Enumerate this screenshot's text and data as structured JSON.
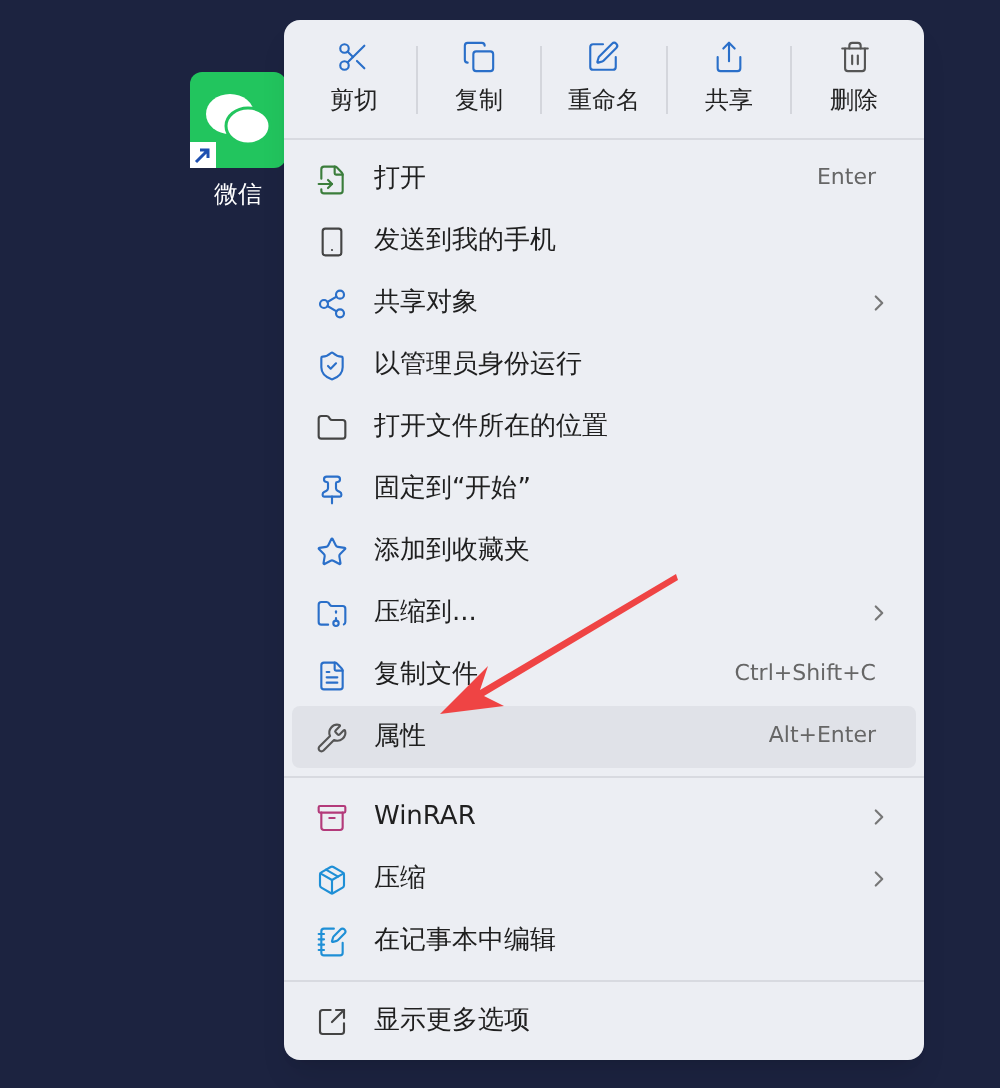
{
  "desktop_icon": {
    "label": "微信"
  },
  "toolbar": [
    {
      "label": "剪切"
    },
    {
      "label": "复制"
    },
    {
      "label": "重命名"
    },
    {
      "label": "共享"
    },
    {
      "label": "删除"
    }
  ],
  "menu_groups": [
    [
      {
        "label": "打开",
        "shortcut": "Enter",
        "submenu": false,
        "selected": false
      },
      {
        "label": "发送到我的手机",
        "submenu": false,
        "selected": false
      },
      {
        "label": "共享对象",
        "submenu": true,
        "selected": false
      },
      {
        "label": "以管理员身份运行",
        "submenu": false,
        "selected": false
      },
      {
        "label": "打开文件所在的位置",
        "submenu": false,
        "selected": false
      },
      {
        "label": "固定到“开始”",
        "submenu": false,
        "selected": false
      },
      {
        "label": "添加到收藏夹",
        "submenu": false,
        "selected": false
      },
      {
        "label": "压缩到...",
        "submenu": true,
        "selected": false
      },
      {
        "label": "复制文件",
        "shortcut": "Ctrl+Shift+C",
        "submenu": false,
        "selected": false
      },
      {
        "label": "属性",
        "shortcut": "Alt+Enter",
        "submenu": false,
        "selected": true
      }
    ],
    [
      {
        "label": "WinRAR",
        "submenu": true,
        "selected": false
      },
      {
        "label": "压缩",
        "submenu": true,
        "selected": false
      },
      {
        "label": "在记事本中编辑",
        "submenu": false,
        "selected": false
      }
    ],
    [
      {
        "label": "显示更多选项",
        "submenu": false,
        "selected": false
      }
    ]
  ]
}
